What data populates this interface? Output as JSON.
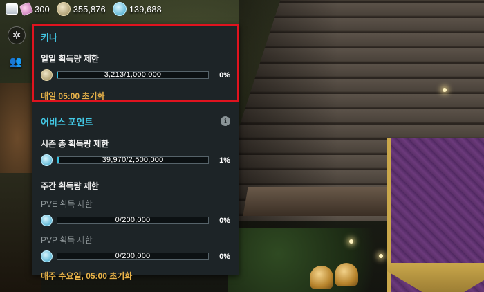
{
  "currency": {
    "items": [
      {
        "icon": "stamina-icon",
        "value": "300"
      },
      {
        "icon": "kina-coin-icon",
        "value": "355,876"
      },
      {
        "icon": "abyss-point-icon",
        "value": "139,688"
      }
    ]
  },
  "side_buttons": [
    {
      "icon": "compass-icon"
    },
    {
      "icon": "party-icon"
    }
  ],
  "panel": {
    "kina": {
      "title": "키나",
      "daily_label": "일일 획득량 제한",
      "progress_text": "3,213/1,000,000",
      "progress_fraction": 0.003213,
      "percent": "0%",
      "reset": "매일 05:00 초기화"
    },
    "abyss": {
      "title": "어비스 포인트",
      "season_label": "시즌 총 획득량 제한",
      "season_progress_text": "39,970/2,500,000",
      "season_fraction": 0.016,
      "season_percent": "1%",
      "weekly_label": "주간 획득량 제한",
      "pve_label": "PVE 획득 제한",
      "pve_progress_text": "0/200,000",
      "pve_fraction": 0,
      "pve_percent": "0%",
      "pvp_label": "PVP 획득 제한",
      "pvp_progress_text": "0/200,000",
      "pvp_fraction": 0,
      "pvp_percent": "0%",
      "reset": "매주 수요일, 05:00 초기화"
    }
  },
  "colors": {
    "accent_cyan": "#43c9e6",
    "reset_gold": "#e9b349",
    "highlight_red": "#e0131f",
    "bar_fill": "#38c0e0"
  }
}
